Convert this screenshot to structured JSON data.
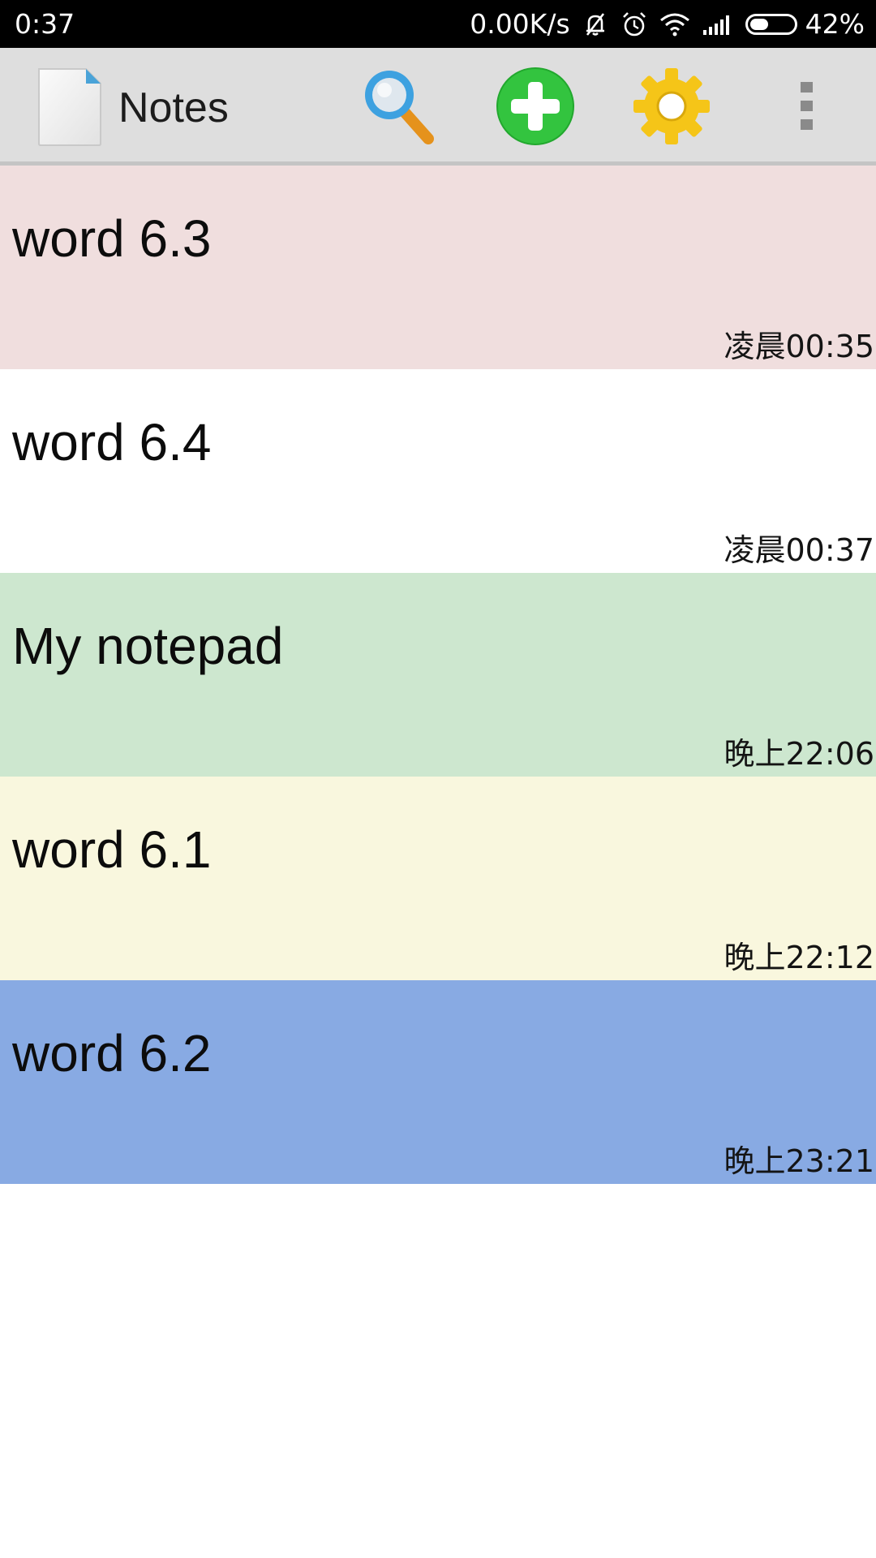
{
  "status_bar": {
    "time": "0:37",
    "net_speed": "0.00K/s",
    "battery_percent_text": "42%",
    "battery_level": 0.42,
    "icons": [
      "bell-muted-icon",
      "alarm-icon",
      "wifi-icon",
      "signal-icon",
      "battery-icon"
    ]
  },
  "action_bar": {
    "app_icon": "document-icon",
    "title": "Notes",
    "actions": [
      {
        "icon": "search-icon"
      },
      {
        "icon": "add-icon",
        "color": "#33c43f"
      },
      {
        "icon": "gear-icon",
        "color": "#f5c518"
      },
      {
        "icon": "overflow-menu-icon"
      }
    ]
  },
  "notes": [
    {
      "title": "word 6.3",
      "time": "凌晨00:35",
      "color": "#f0dede"
    },
    {
      "title": "word 6.4",
      "time": "凌晨00:37",
      "color": "#ffffff"
    },
    {
      "title": "My notepad",
      "time": "晚上22:06",
      "color": "#cde7cf"
    },
    {
      "title": "word 6.1",
      "time": "晚上22:12",
      "color": "#f9f7de"
    },
    {
      "title": "word 6.2",
      "time": "晚上23:21",
      "color": "#88aae3"
    }
  ]
}
